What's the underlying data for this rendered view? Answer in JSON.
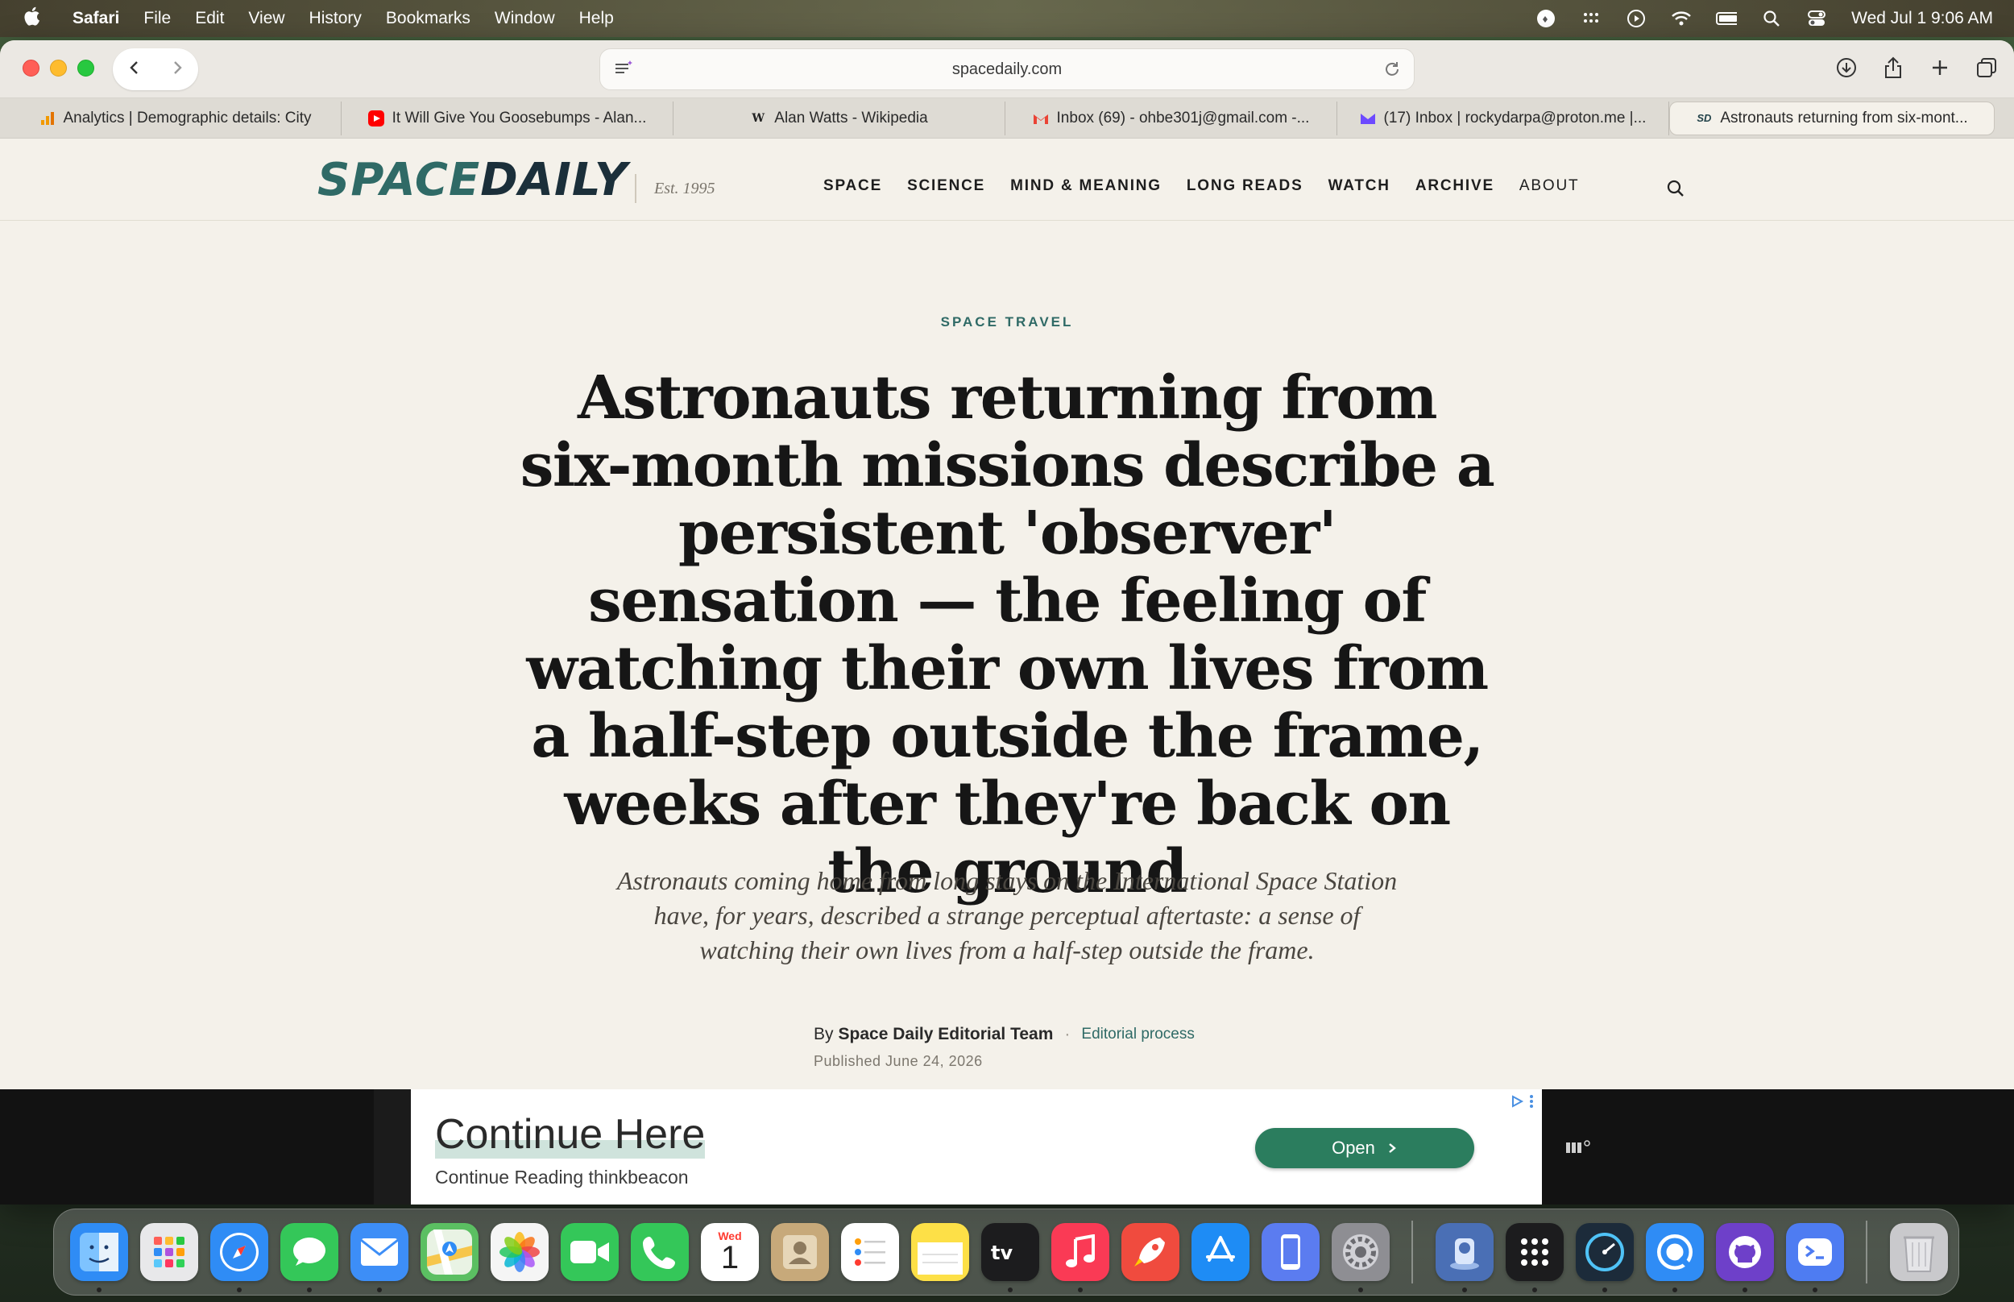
{
  "menubar": {
    "app": "Safari",
    "items": [
      "File",
      "Edit",
      "View",
      "History",
      "Bookmarks",
      "Window",
      "Help"
    ],
    "clock": "Wed Jul 1  9:06 AM"
  },
  "browser": {
    "url": "spacedaily.com",
    "tabs": [
      {
        "label": "Analytics | Demographic details: City",
        "icon": "analytics-icon",
        "color": "#f29900"
      },
      {
        "label": "It Will Give You Goosebumps - Alan...",
        "icon": "youtube-icon",
        "color": "#ff0000"
      },
      {
        "label": "Alan Watts - Wikipedia",
        "icon": "wikipedia-icon",
        "color": "#222222"
      },
      {
        "label": "Inbox (69) - ohbe301j@gmail.com -...",
        "icon": "gmail-icon",
        "color": "#ea4335"
      },
      {
        "label": "(17) Inbox | rockydarpa@proton.me |...",
        "icon": "proton-icon",
        "color": "#6d4aff"
      },
      {
        "label": "Astronauts returning from six-mont...",
        "icon": "spacedaily-icon",
        "color": "#23434a"
      }
    ]
  },
  "site": {
    "logo_part1": "SPACE",
    "logo_part2": "DAILY",
    "est": "Est. 1995",
    "nav": [
      "SPACE",
      "SCIENCE",
      "MIND & MEANING",
      "LONG READS",
      "WATCH",
      "ARCHIVE",
      "ABOUT"
    ]
  },
  "article": {
    "kicker": "SPACE TRAVEL",
    "headline": "Astronauts returning from six-month missions describe a persistent 'observer' sensation — the feeling of watching their own lives from a half-step outside the frame, weeks after they're back on the ground",
    "dek": "Astronauts coming home from long stays on the International Space Station have, for years, described a strange perceptual aftertaste: a sense of watching their own lives from a half-step outside the frame.",
    "by_prefix": "By",
    "author": "Space Daily Editorial Team",
    "separator": "·",
    "editorial_process": "Editorial process",
    "published": "Published June 24, 2026"
  },
  "ad": {
    "title": "Continue Here",
    "subtitle": "Continue Reading thinkbeacon",
    "button": "Open"
  },
  "dock": {
    "apps": [
      {
        "name": "finder-icon",
        "color": "#2f8cf5"
      },
      {
        "name": "launchpad-icon",
        "color": "#e8e8ea"
      },
      {
        "name": "safari-icon",
        "color": "#2f8cf5"
      },
      {
        "name": "messages-icon",
        "color": "#34c759"
      },
      {
        "name": "mail-icon",
        "color": "#3d8ef7"
      },
      {
        "name": "maps-icon",
        "color": "#5bbf62"
      },
      {
        "name": "photos-icon",
        "color": "#f5f5f5"
      },
      {
        "name": "facetime-icon",
        "color": "#34c759"
      },
      {
        "name": "phone-icon",
        "color": "#34c759"
      },
      {
        "name": "calendar-icon",
        "color": "#ffffff"
      },
      {
        "name": "contacts-icon",
        "color": "#c7a97a"
      },
      {
        "name": "reminders-icon",
        "color": "#ffffff"
      },
      {
        "name": "notes-icon",
        "color": "#fde047"
      },
      {
        "name": "tv-icon",
        "color": "#1c1c1e"
      },
      {
        "name": "music-icon",
        "color": "#fa3a55"
      },
      {
        "name": "rocket-icon",
        "color": "#f04b3e"
      },
      {
        "name": "app-store-icon",
        "color": "#1e8cf5"
      },
      {
        "name": "simulator-icon",
        "color": "#5b7cf0"
      },
      {
        "name": "system-settings-icon",
        "color": "#8e8e93"
      }
    ],
    "extras": [
      {
        "name": "preview-icon",
        "color": "#4a6fb5"
      },
      {
        "name": "dots-icon",
        "color": "#1c1c1e"
      },
      {
        "name": "speedometer-icon",
        "color": "#1c2b3a"
      },
      {
        "name": "quicktime-icon",
        "color": "#2f8cf5"
      },
      {
        "name": "github-icon",
        "color": "#6e40c9"
      },
      {
        "name": "terminal-icon",
        "color": "#4e7cf2"
      },
      {
        "name": "trash-icon",
        "color": "#c9c9cc"
      }
    ],
    "calendar_day": "Wed",
    "calendar_date": "1"
  }
}
